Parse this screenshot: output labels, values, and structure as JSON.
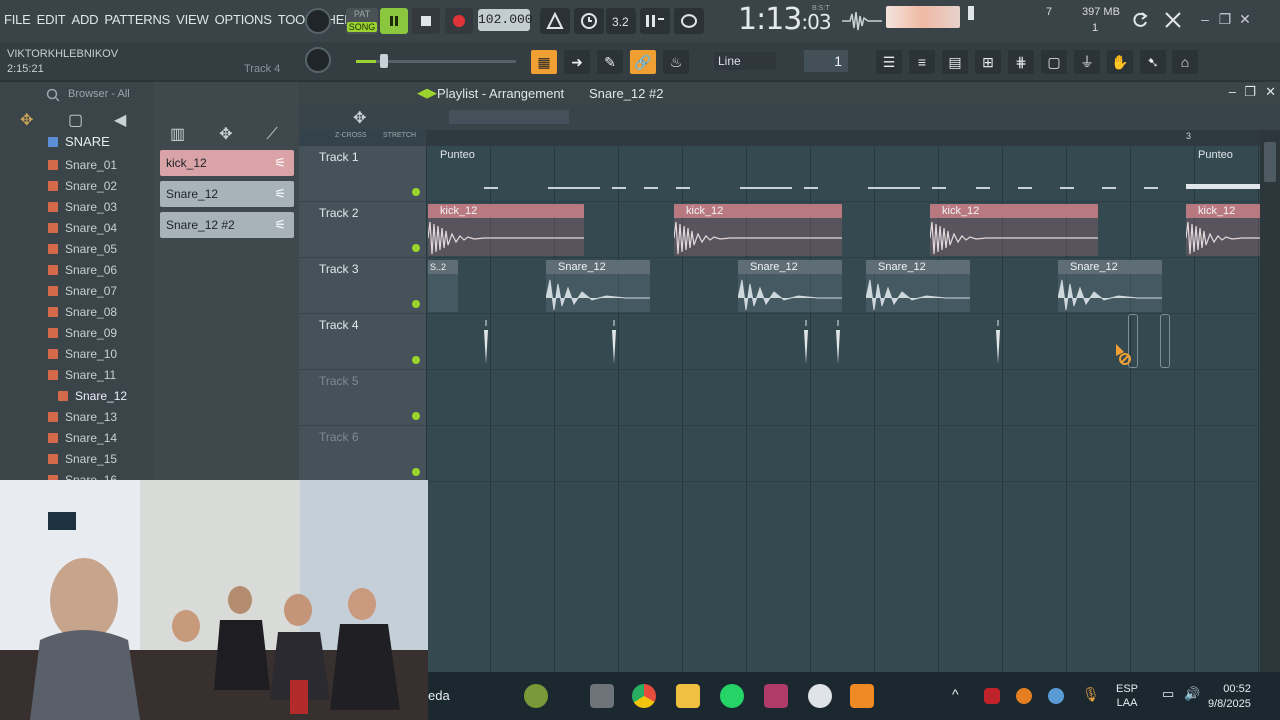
{
  "menu": [
    "FILE",
    "EDIT",
    "ADD",
    "PATTERNS",
    "VIEW",
    "OPTIONS",
    "TOOLS",
    "HELP"
  ],
  "transport": {
    "mode_top": "PAT",
    "mode_selected": "SONG",
    "tempo": "102.000",
    "time_main": "1:13",
    "time_small": ":03",
    "time_format": "B:S:T"
  },
  "monitor": {
    "cpu_count": "7",
    "memory": "397 MB",
    "polyphony": "1"
  },
  "hint": {
    "user": "VIKTORKHLEBNIKOV",
    "time": "2:15:21",
    "track": "Track 4"
  },
  "snap": {
    "mode": "Line",
    "step": "1"
  },
  "browser": {
    "title": "Browser - All",
    "folder": "SNARE",
    "items": [
      "Snare_01",
      "Snare_02",
      "Snare_03",
      "Snare_04",
      "Snare_05",
      "Snare_06",
      "Snare_07",
      "Snare_08",
      "Snare_09",
      "Snare_10",
      "Snare_11",
      "Snare_12",
      "Snare_13",
      "Snare_14",
      "Snare_15",
      "Snare_16"
    ],
    "selected": "Snare_12"
  },
  "channels": [
    {
      "name": "kick_12",
      "color": "#d9a3a8"
    },
    {
      "name": "Snare_12",
      "color": "#a7b3b9"
    },
    {
      "name": "Snare_12 #2",
      "color": "#a7b3b9"
    }
  ],
  "playlist": {
    "title": "Playlist - Arrangement",
    "pattern": "Snare_12 #2",
    "ruler_mark": "3",
    "toolbar": {
      "zcross": "Z-CROSS",
      "stretch": "STRETCH"
    },
    "tracks": [
      {
        "name": "Track 1",
        "active": true
      },
      {
        "name": "Track 2",
        "active": true
      },
      {
        "name": "Track 3",
        "active": true
      },
      {
        "name": "Track 4",
        "active": true
      },
      {
        "name": "Track 5",
        "active": false
      },
      {
        "name": "Track 6",
        "active": false
      }
    ],
    "clips": {
      "punteo_a": "Punteo",
      "punteo_b": "Punteo",
      "kick": "kick_12",
      "snare": "Snare_12",
      "snare_short": "S..2"
    }
  },
  "taskbar": {
    "search": "eda",
    "lang_top": "ESP",
    "lang_bottom": "LAA",
    "time": "00:52",
    "date": "9/8/2025"
  },
  "colors": {
    "accent_green": "#9bd32f",
    "accent_orange": "#f0a032",
    "kick_clip": "#b87a80",
    "snare_clip": "#5f6d74"
  }
}
